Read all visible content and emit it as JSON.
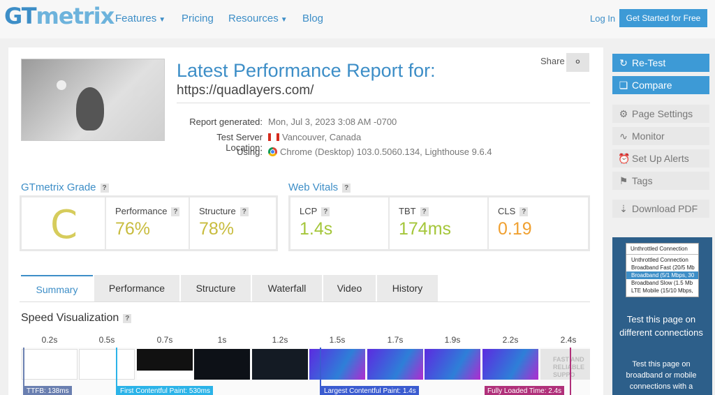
{
  "header": {
    "logo_gt": "GT",
    "logo_rest": "metrix",
    "nav": [
      "Features",
      "Pricing",
      "Resources",
      "Blog"
    ],
    "login": "Log In",
    "cta": "Get Started for Free"
  },
  "report": {
    "title": "Latest Performance Report for:",
    "url": "https://quadlayers.com/",
    "share": "Share",
    "generated_label": "Report generated:",
    "generated_value": "Mon, Jul 3, 2023 3:08 AM -0700",
    "location_label": "Test Server Location:",
    "location_value": "Vancouver, Canada",
    "using_label": "Using:",
    "using_value": "Chrome (Desktop) 103.0.5060.134, Lighthouse 9.6.4"
  },
  "grade": {
    "title": "GTmetrix Grade",
    "letter": "C",
    "performance_label": "Performance",
    "performance_value": "76%",
    "structure_label": "Structure",
    "structure_value": "78%"
  },
  "vitals": {
    "title": "Web Vitals",
    "lcp_label": "LCP",
    "lcp_value": "1.4s",
    "tbt_label": "TBT",
    "tbt_value": "174ms",
    "cls_label": "CLS",
    "cls_value": "0.19"
  },
  "tabs": [
    "Summary",
    "Performance",
    "Structure",
    "Waterfall",
    "Video",
    "History"
  ],
  "speed": {
    "title": "Speed Visualization",
    "times": [
      "0.2s",
      "0.5s",
      "0.7s",
      "1s",
      "1.2s",
      "1.5s",
      "1.7s",
      "1.9s",
      "2.2s",
      "2.4s"
    ],
    "frame_text": "FAST AND RELIABLE SUPPO",
    "ttfb": "TTFB: 138ms",
    "fcp": "First Contentful Paint: 530ms",
    "lcp": "Largest Contentful Paint: 1.4s",
    "flt": "Fully Loaded Time: 2.4s"
  },
  "sidebar": {
    "retest": "Re-Test",
    "compare": "Compare",
    "page_settings": "Page Settings",
    "monitor": "Monitor",
    "alerts": "Set Up Alerts",
    "tags": "Tags",
    "download": "Download PDF",
    "select_current": "Unthrottled Connection",
    "select_options": [
      "Unthrottled Connection",
      "Broadband Fast (20/5 Mb",
      "Broadband (5/1 Mbps, 30",
      "Broadband Slow (1.5 Mb",
      "LTE Mobile (15/10 Mbps,"
    ],
    "conn_heading": "Test this page on different connections",
    "conn_text": "Test this page on broadband or mobile connections with a"
  },
  "colors": {
    "accent": "#3d9ad6",
    "grade_c": "#d6cc5c",
    "good": "#a4c639",
    "warn": "#f0a030",
    "ttfb": "#6a7fb0",
    "fcp": "#2bb3e8",
    "lcp": "#3a5bd0",
    "flt": "#b0307a"
  }
}
